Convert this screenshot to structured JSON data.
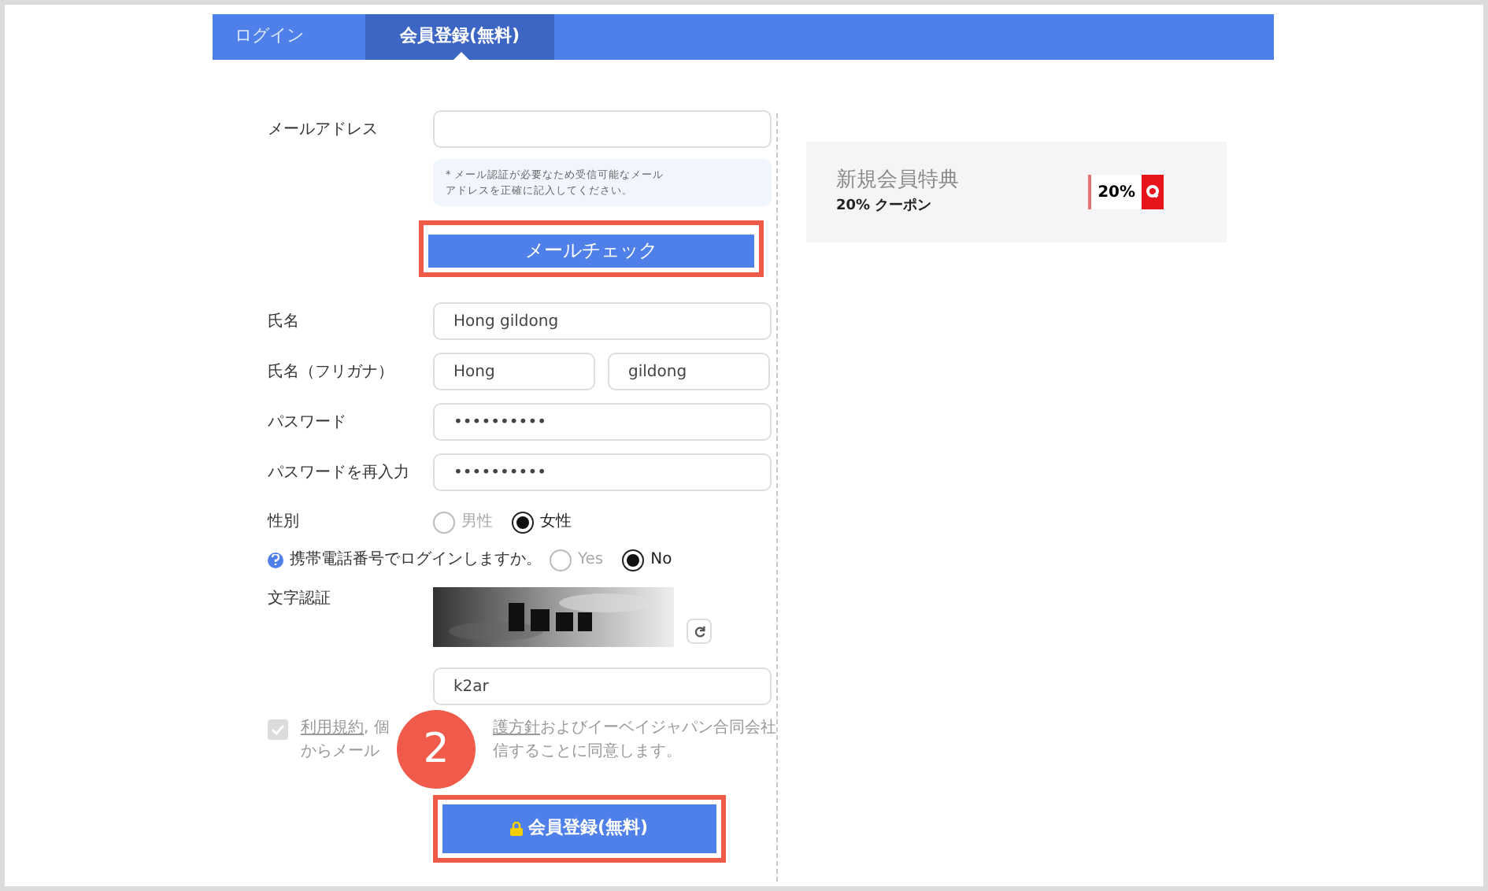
{
  "tabs": [
    {
      "label": "ログイン",
      "selected": false
    },
    {
      "label": "会員登録(無料)",
      "selected": true
    }
  ],
  "form": {
    "email": {
      "label": "メールアドレス",
      "hint": [
        "* メール認証が必要なため受信可能なメール",
        "アドレスを正確に記入してください。"
      ],
      "button": "メールチェック",
      "highlighted": true
    },
    "rows": [
      {
        "kind": "text",
        "label": "氏名",
        "values": [
          "Hong gildong"
        ]
      },
      {
        "kind": "text",
        "label": "氏名（フリガナ）",
        "values": [
          "Hong",
          "gildong"
        ]
      },
      {
        "kind": "text",
        "label": "パスワード",
        "values": [
          "••••••••••"
        ]
      },
      {
        "kind": "text",
        "label": "パスワードを再入力",
        "values": [
          "••••••••••"
        ]
      },
      {
        "kind": "radio",
        "label": "性別",
        "options": [
          {
            "label": "男性",
            "selected": false
          },
          {
            "label": "女性",
            "selected": true
          }
        ]
      },
      {
        "kind": "radio_help",
        "label": "携帯電話番号でログインしますか。",
        "options": [
          {
            "label": "Yes",
            "selected": false
          },
          {
            "label": "No",
            "selected": true
          }
        ]
      },
      {
        "kind": "captcha",
        "label": "文字認証",
        "values": [
          "k2ar"
        ]
      }
    ],
    "consent": {
      "checked": true,
      "lines": [
        {
          "left": [
            {
              "text": "利用規約",
              "link": true
            },
            {
              "text": ", 個",
              "link": false
            }
          ],
          "right": [
            {
              "text": "護方針",
              "link": true
            },
            {
              "text": "およびイーベイジャパン合同会社",
              "link": false
            }
          ]
        },
        {
          "left": [
            {
              "text": "からメール",
              "link": false
            }
          ],
          "right": [
            {
              "text": "信することに同意します。",
              "link": false
            }
          ]
        }
      ]
    },
    "submit": {
      "label": "会員登録(無料)",
      "highlighted": true
    }
  },
  "benefit": {
    "title": "新規会員特典",
    "subtitle": "20% クーポン",
    "coupon": "20%"
  },
  "annotations": [
    {
      "kind": "step_marker",
      "label": "2"
    }
  ]
}
